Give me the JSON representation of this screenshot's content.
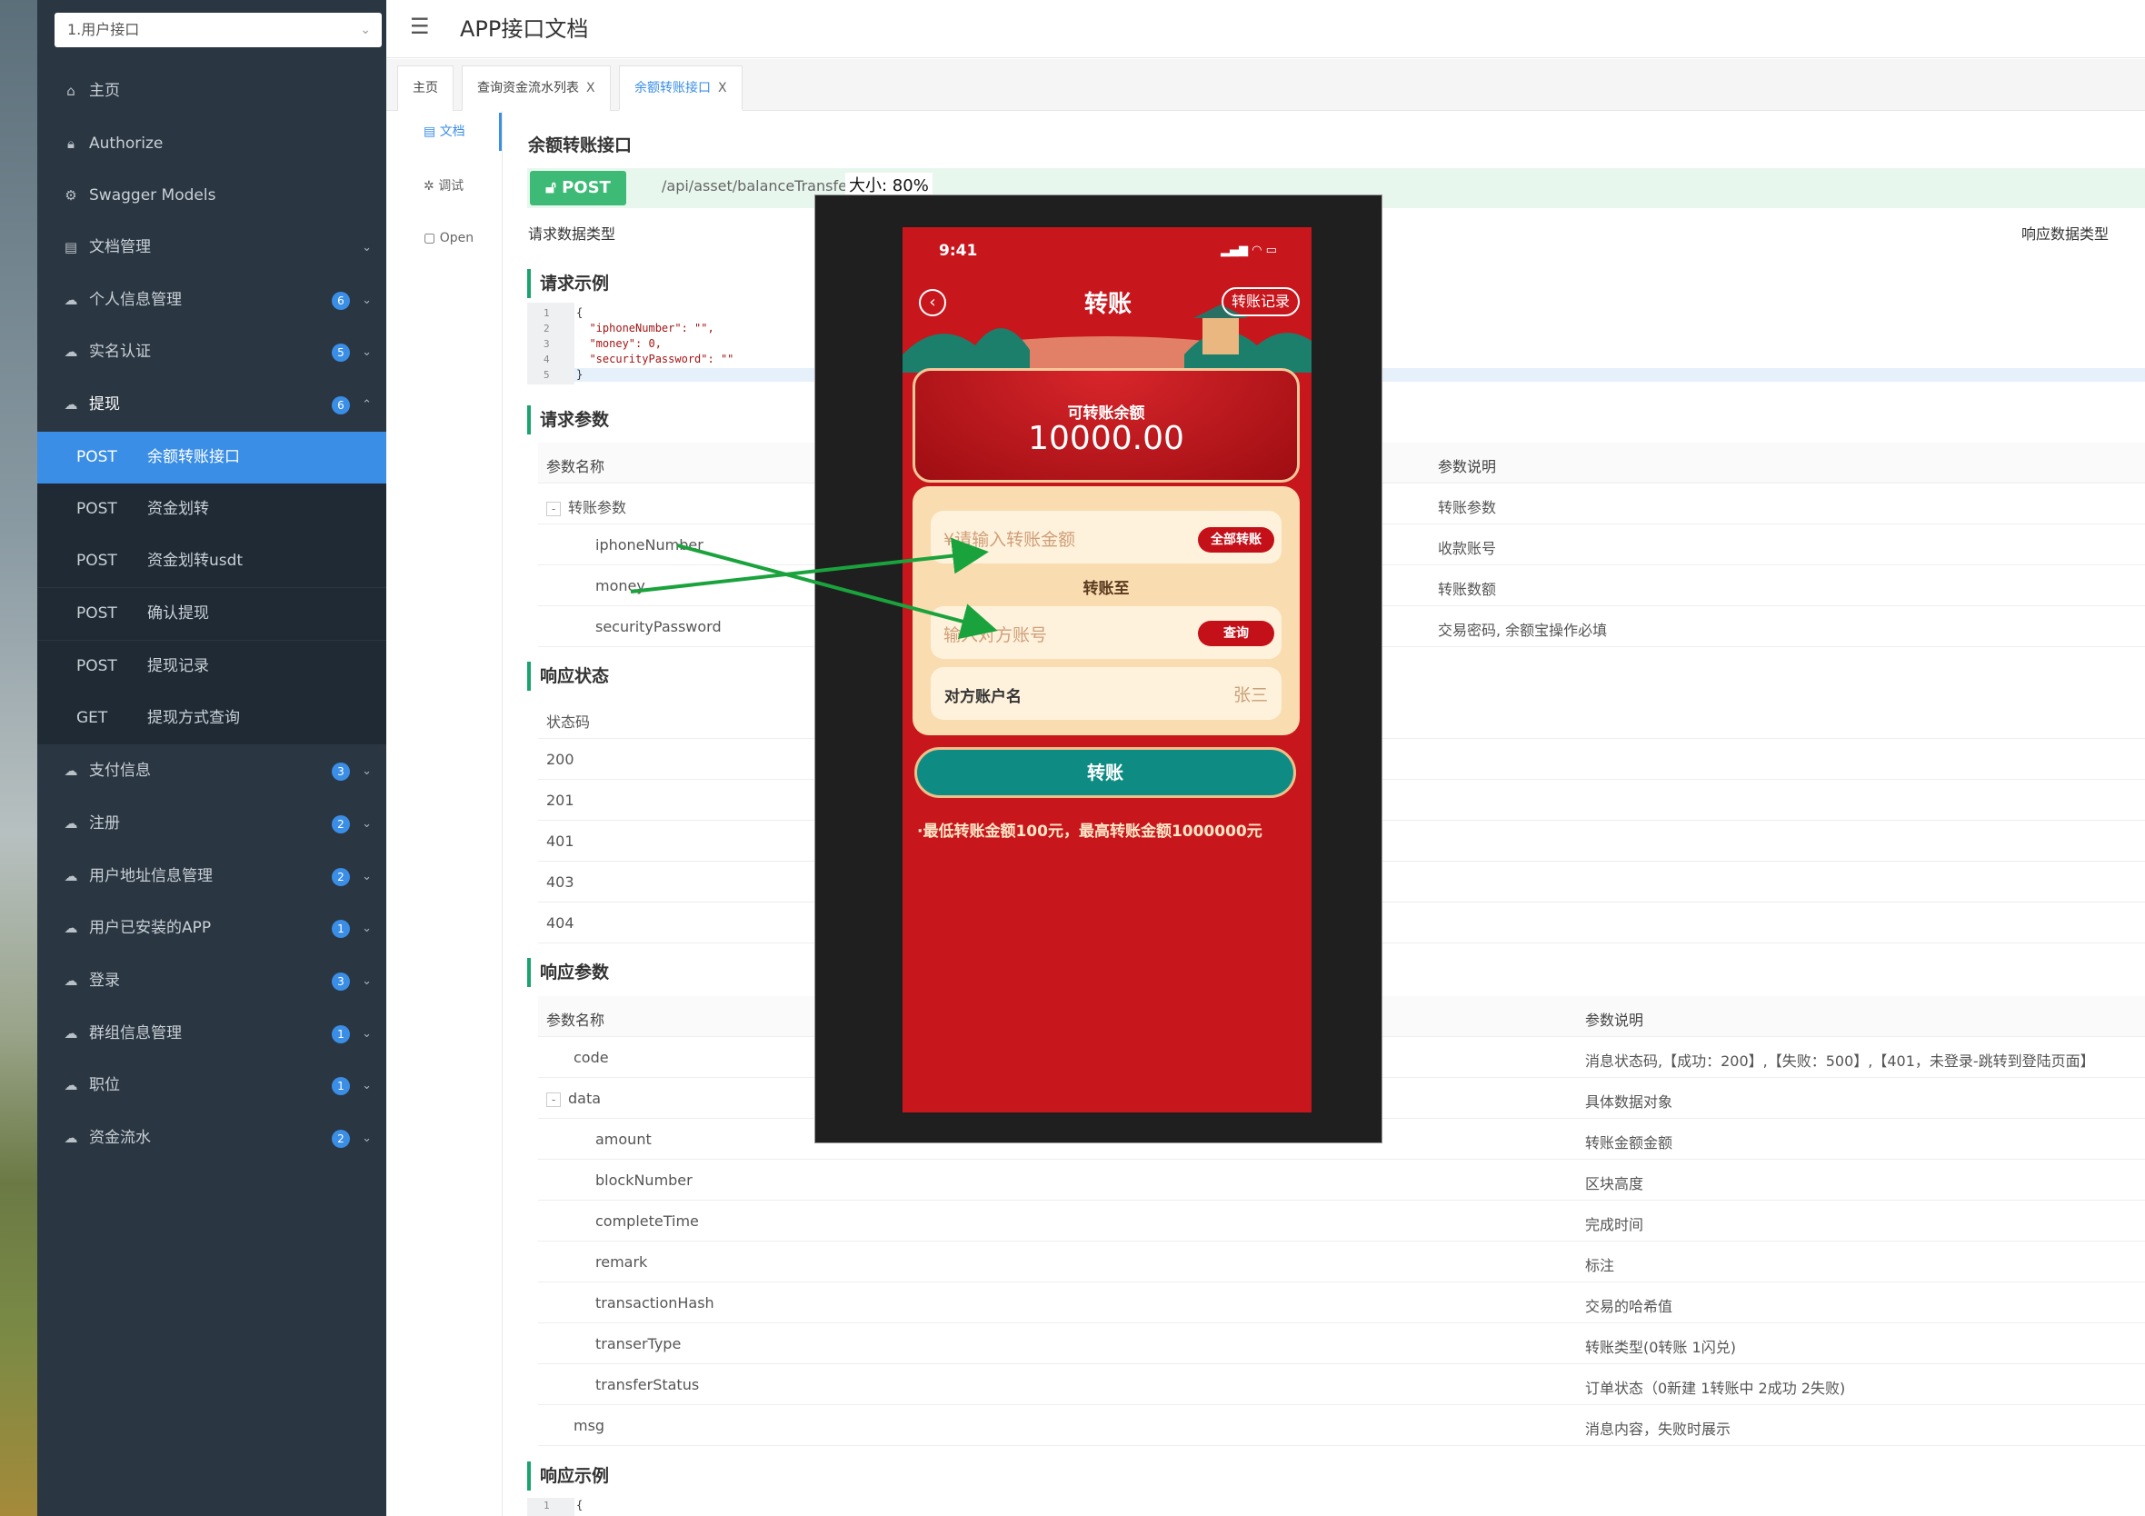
{
  "project_select": {
    "value": "1.用户接口"
  },
  "header": {
    "title": "APP接口文档"
  },
  "sidebar": {
    "items": [
      {
        "icon": "home-icon",
        "label": "主页"
      },
      {
        "icon": "lock-icon",
        "label": "Authorize"
      },
      {
        "icon": "gear-icon",
        "label": "Swagger Models"
      },
      {
        "icon": "document-icon",
        "label": "文档管理"
      },
      {
        "icon": "cloud-icon",
        "label": "个人信息管理",
        "count": "6"
      },
      {
        "icon": "cloud-icon",
        "label": "实名认证",
        "count": "5"
      },
      {
        "icon": "cloud-icon",
        "label": "提现",
        "count": "6"
      }
    ],
    "sub_items": [
      {
        "method": "POST",
        "label": "余额转账接口"
      },
      {
        "method": "POST",
        "label": "资金划转"
      },
      {
        "method": "POST",
        "label": "资金划转usdt"
      },
      {
        "method": "POST",
        "label": "确认提现"
      },
      {
        "method": "POST",
        "label": "提现记录"
      },
      {
        "method": "GET",
        "label": "提现方式查询"
      }
    ],
    "more_items": [
      {
        "icon": "cloud-icon",
        "label": "支付信息",
        "count": "3"
      },
      {
        "icon": "cloud-icon",
        "label": "注册",
        "count": "2"
      },
      {
        "icon": "cloud-icon",
        "label": "用户地址信息管理",
        "count": "2"
      },
      {
        "icon": "cloud-icon",
        "label": "用户已安装的APP",
        "count": "1"
      },
      {
        "icon": "cloud-icon",
        "label": "登录",
        "count": "3"
      },
      {
        "icon": "cloud-icon",
        "label": "群组信息管理",
        "count": "1"
      },
      {
        "icon": "cloud-icon",
        "label": "职位",
        "count": "1"
      },
      {
        "icon": "cloud-icon",
        "label": "资金流水",
        "count": "2"
      }
    ]
  },
  "tabs": [
    {
      "label": "主页"
    },
    {
      "label": "查询资金流水列表",
      "close": "X"
    },
    {
      "label": "余额转账接口",
      "close": "X"
    }
  ],
  "subnav": {
    "doc": "文档",
    "debug": "调试",
    "open": "Open"
  },
  "api": {
    "title": "余额转账接口",
    "method": "POST",
    "path": "/api/asset/balanceTransfer",
    "zoom_label": "大小: 80%",
    "request_type_label": "请求数据类型",
    "response_type_label": "响应数据类型"
  },
  "request_example": {
    "title": "请求示例",
    "line_numbers": [
      "1",
      "2",
      "3",
      "4",
      "5"
    ],
    "lines": [
      "{",
      "  \"iphoneNumber\": \"\",",
      "  \"money\": 0,",
      "  \"securityPassword\": \"\"",
      "}"
    ]
  },
  "request_params": {
    "title": "请求参数",
    "col_name": "参数名称",
    "col_desc": "参数说明",
    "rows": [
      {
        "name": "转账参数",
        "desc": "转账参数"
      },
      {
        "name": "iphoneNumber",
        "desc": "收款账号"
      },
      {
        "name": "money",
        "desc": "转账数额"
      },
      {
        "name": "securityPassword",
        "desc": "交易密码, 余额宝操作必填"
      }
    ]
  },
  "response_status": {
    "title": "响应状态",
    "col": "状态码",
    "codes": [
      "200",
      "201",
      "401",
      "403",
      "404"
    ]
  },
  "response_params": {
    "title": "响应参数",
    "col_name": "参数名称",
    "col_desc": "参数说明",
    "rows": [
      {
        "name": "code",
        "desc": "消息状态码,【成功：200】,【失败：500】,【401，未登录-跳转到登陆页面】"
      },
      {
        "name": "data",
        "desc": "具体数据对象"
      },
      {
        "name": "amount",
        "desc": "转账金额金额"
      },
      {
        "name": "blockNumber",
        "desc": "区块高度"
      },
      {
        "name": "completeTime",
        "desc": "完成时间"
      },
      {
        "name": "remark",
        "desc": "标注"
      },
      {
        "name": "transactionHash",
        "desc": "交易的哈希值"
      },
      {
        "name": "transerType",
        "desc": "转账类型(0转账 1闪兑)"
      },
      {
        "name": "transferStatus",
        "desc": "订单状态（0新建 1转账中 2成功 2失败)"
      },
      {
        "name": "msg",
        "desc": "消息内容，失败时展示"
      }
    ]
  },
  "response_example": {
    "title": "响应示例",
    "line1": "1",
    "code1": "{"
  },
  "phone": {
    "time": "9:41",
    "title": "转账",
    "record_button": "转账记录",
    "balance_label": "可转账余额",
    "balance_value": "10000.00",
    "amount_placeholder": "¥请输入转账金额",
    "all_button": "全部转账",
    "to_label": "转账至",
    "account_placeholder": "输入对方账号",
    "query_button": "查询",
    "name_label": "对方账户名",
    "name_value": "张三",
    "submit_button": "转账",
    "note": "·最低转账金额100元，最高转账金额1000000元"
  },
  "colors": {
    "sidebar": "#2a3642",
    "accent": "#3a8ee6",
    "post_green": "#3dbb76",
    "phone_red": "#c8161d",
    "arrow": "#1aa33c"
  }
}
